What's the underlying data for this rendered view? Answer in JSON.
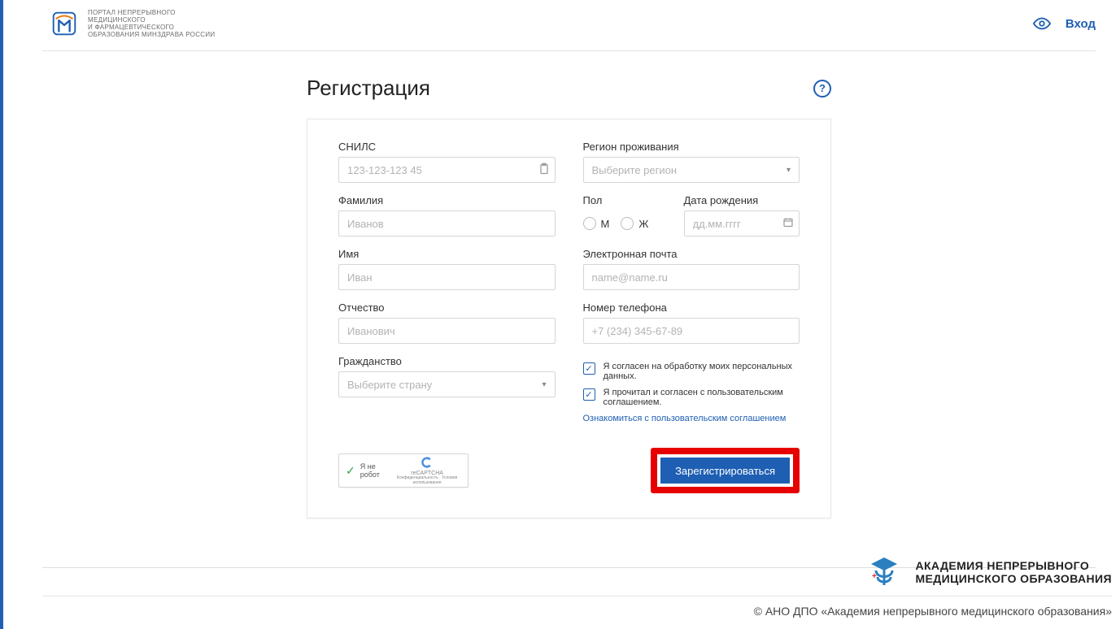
{
  "header": {
    "brand_text": "ПОРТАЛ НЕПРЕРЫВНОГО\nМЕДИЦИНСКОГО\nИ ФАРМАЦЕВТИЧЕСКОГО\nОБРАЗОВАНИЯ МИНЗДРАВА РОССИИ",
    "login": "Вход"
  },
  "page": {
    "title": "Регистрация"
  },
  "form": {
    "snils": {
      "label": "СНИЛС",
      "placeholder": "123-123-123 45"
    },
    "lastname": {
      "label": "Фамилия",
      "placeholder": "Иванов"
    },
    "firstname": {
      "label": "Имя",
      "placeholder": "Иван"
    },
    "patronymic": {
      "label": "Отчество",
      "placeholder": "Иванович"
    },
    "citizenship": {
      "label": "Гражданство",
      "placeholder": "Выберите страну"
    },
    "region": {
      "label": "Регион проживания",
      "placeholder": "Выберите регион"
    },
    "gender": {
      "label": "Пол",
      "m": "М",
      "f": "Ж"
    },
    "dob": {
      "label": "Дата рождения",
      "placeholder": "дд.мм.гггг"
    },
    "email": {
      "label": "Электронная почта",
      "placeholder": "name@name.ru"
    },
    "phone": {
      "label": "Номер телефона",
      "placeholder": "+7 (234) 345-67-89"
    },
    "check_pd": "Я согласен на обработку моих персональных данных.",
    "check_terms": "Я прочитал и согласен с пользовательским соглашением.",
    "terms_link": "Ознакомиться с пользовательским соглашением",
    "recaptcha": {
      "label": "Я не робот",
      "brand": "reCAPTCHA",
      "sub": "Конфиденциальность · Условия использования"
    },
    "submit": "Зарегистрироваться"
  },
  "footer": {
    "brand_l1": "АКАДЕМИЯ НЕПРЕРЫВНОГО",
    "brand_l2": "МЕДИЦИНСКОГО ОБРАЗОВАНИЯ",
    "copyright": "© АНО ДПО «Академия непрерывного медицинского образования»"
  }
}
